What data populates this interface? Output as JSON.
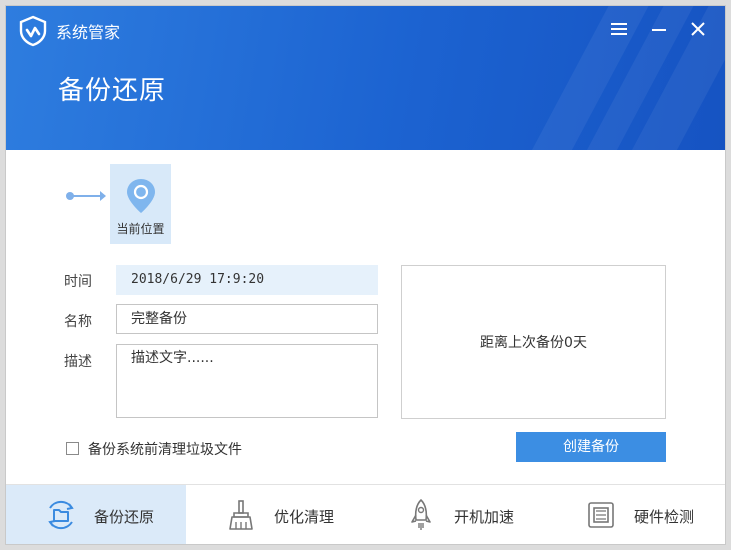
{
  "app": {
    "title": "系统管家"
  },
  "page": {
    "title": "备份还原"
  },
  "timeline": {
    "current_label": "当前位置"
  },
  "form": {
    "time_label": "时间",
    "time_value": "2018/6/29  17:9:20",
    "name_label": "名称",
    "name_value": "完整备份",
    "desc_label": "描述",
    "desc_value": "描述文字......"
  },
  "info": {
    "text": "距离上次备份0天"
  },
  "options": {
    "clean_label": "备份系统前清理垃圾文件",
    "clean_checked": false
  },
  "actions": {
    "create_label": "创建备份"
  },
  "nav": [
    {
      "label": "备份还原",
      "icon": "folder-sync-icon",
      "active": true
    },
    {
      "label": "优化清理",
      "icon": "broom-icon",
      "active": false
    },
    {
      "label": "开机加速",
      "icon": "rocket-icon",
      "active": false
    },
    {
      "label": "硬件检测",
      "icon": "chip-icon",
      "active": false
    }
  ],
  "colors": {
    "accent": "#1c63d1",
    "primary_button": "#3c8ee3",
    "active_nav": "#dbeaf9"
  }
}
